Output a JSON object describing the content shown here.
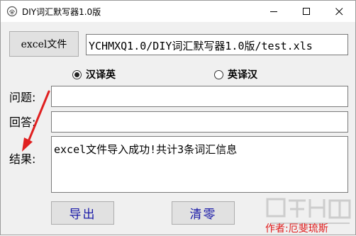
{
  "window": {
    "title": "DIY词汇默写器1.0版",
    "icon": "fingerprint-app-icon"
  },
  "excel_button_label": "excel文件",
  "file_path": "YCHMXQ1.0/DIY词汇默写器1.0版/test.xls",
  "mode": {
    "options": [
      {
        "label": "汉译英",
        "checked": true
      },
      {
        "label": "英译汉",
        "checked": false
      }
    ]
  },
  "labels": {
    "question": "问题:",
    "answer": "回答:",
    "result": "结果:"
  },
  "fields": {
    "question_value": "",
    "answer_value": "",
    "result_text": "excel文件导入成功!共计3条词汇信息"
  },
  "buttons": {
    "export": "导出",
    "clear": "清零"
  },
  "overlay": {
    "author": "作者:厄斐琉斯",
    "arrow_color": "#e02020"
  }
}
